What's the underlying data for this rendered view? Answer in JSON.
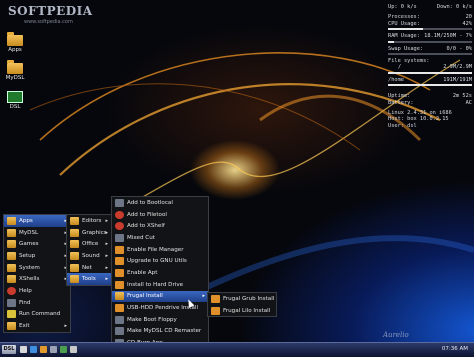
{
  "watermark": {
    "title": "SOFTPEDIA",
    "subtitle": "www.softpedia.com"
  },
  "desktop_icons": [
    {
      "label": "Apps",
      "icon": "folder-icon"
    },
    {
      "label": "MyDSL",
      "icon": "folder-icon"
    },
    {
      "label": "DSL",
      "icon": "monitor-icon"
    }
  ],
  "sysmon": {
    "up_label": "Up:",
    "up_value": "0 k/s",
    "down_label": "Down:",
    "down_value": "0 k/s",
    "processes_label": "Processes:",
    "processes_value": "20",
    "cpu_label": "CPU Usage:",
    "cpu_value": "42%",
    "ram_label": "RAM Usage:",
    "ram_value": "18.1M/250M - 7%",
    "swap_label": "Swap Usage:",
    "swap_value": "0/0 - 0%",
    "fs_label": "File systems:",
    "fs_root_label": "/",
    "fs_root_value": "2.9M/2.9M",
    "fs_home_label": "/home",
    "fs_home_value": "191M/191M",
    "uptime_label": "Uptime:",
    "uptime_value": "2m 52s",
    "battery_label": "Battery:",
    "battery_value": "AC",
    "kernel": "Linux  2.4.31 on i686",
    "host_label": "Host: box",
    "host_value": "10.0.2.15",
    "user_label": "User:",
    "user_value": "dsl",
    "cpu_fraction": 0.42,
    "ram_fraction": 0.07,
    "swap_fraction": 0.0,
    "fs_root_fraction": 1.0,
    "fs_home_fraction": 1.0
  },
  "start_menu": [
    {
      "label": "Apps",
      "icon": "folder-icon",
      "selected": true,
      "submenu": true
    },
    {
      "label": "MyDSL",
      "icon": "folder-icon",
      "submenu": true
    },
    {
      "label": "Games",
      "icon": "folder-icon",
      "submenu": true
    },
    {
      "label": "Setup",
      "icon": "folder-icon",
      "submenu": true
    },
    {
      "label": "System",
      "icon": "folder-icon",
      "submenu": true
    },
    {
      "label": "XShells",
      "icon": "folder-icon",
      "submenu": true
    },
    {
      "label": "Help",
      "icon": "help-icon"
    },
    {
      "label": "Find",
      "icon": "find-icon"
    },
    {
      "label": "Run Command",
      "icon": "run-icon"
    },
    {
      "label": "Exit",
      "icon": "exit-icon",
      "submenu": true
    }
  ],
  "apps_menu": [
    {
      "label": "Editors",
      "icon": "folder-icon",
      "submenu": true
    },
    {
      "label": "Graphics",
      "icon": "folder-icon",
      "submenu": true
    },
    {
      "label": "Office",
      "icon": "folder-icon",
      "submenu": true
    },
    {
      "label": "Sound",
      "icon": "folder-icon",
      "submenu": true
    },
    {
      "label": "Net",
      "icon": "folder-icon",
      "submenu": true
    },
    {
      "label": "Tools",
      "icon": "folder-icon",
      "submenu": true,
      "selected": true
    }
  ],
  "tools_menu": [
    {
      "label": "Add to Bootlocal",
      "icon": "gear-icon"
    },
    {
      "label": "Add to Filetool",
      "icon": "record-icon"
    },
    {
      "label": "Add to XShelf",
      "icon": "record-icon"
    },
    {
      "label": "Mixed Cut",
      "icon": "gear-icon"
    },
    {
      "label": "Enable File Manager",
      "icon": "gear-icon"
    },
    {
      "label": "Upgrade to GNU Utils",
      "icon": "gear-icon"
    },
    {
      "label": "Enable Apt",
      "icon": "gear-icon"
    },
    {
      "label": "Install to Hard Drive",
      "icon": "gear-icon"
    },
    {
      "label": "Frugal Install",
      "icon": "folder-icon",
      "submenu": true,
      "selected": true
    },
    {
      "label": "USB-HDD Pendrive Install",
      "icon": "gear-icon"
    },
    {
      "label": "Make Boot Floppy",
      "icon": "gear-icon"
    },
    {
      "label": "Make MyDSL CD Remaster",
      "icon": "gear-icon"
    },
    {
      "label": "CD Burn App",
      "icon": "gear-icon"
    }
  ],
  "frugal_menu": [
    {
      "label": "Frugal Grub Install",
      "icon": "install-icon"
    },
    {
      "label": "Frugal Lilo Install",
      "icon": "install-icon"
    }
  ],
  "taskbar": {
    "start_label": "DSL",
    "clock": "07:36 AM"
  },
  "signature": "Aurelio"
}
